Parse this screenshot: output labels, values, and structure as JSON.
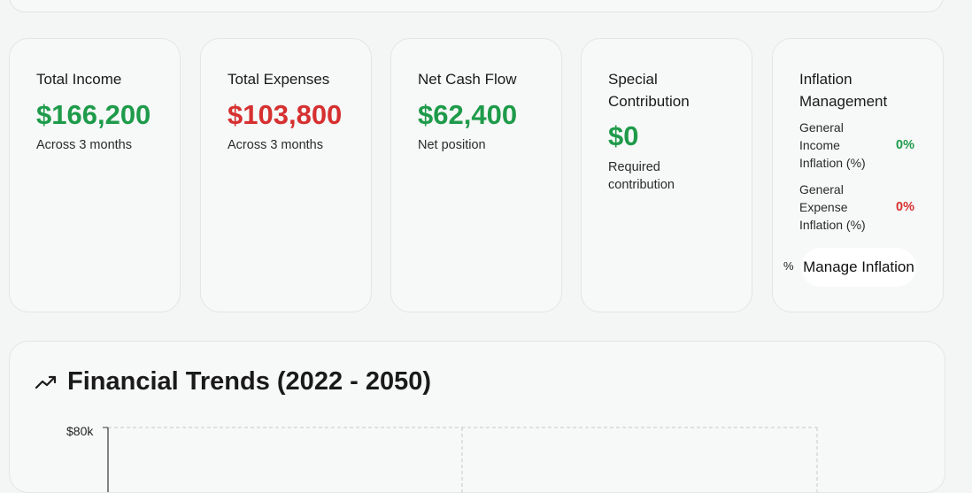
{
  "cards": {
    "income": {
      "title": "Total Income",
      "value": "$166,200",
      "subtitle": "Across 3 months",
      "color": "#1e9b4a"
    },
    "expenses": {
      "title": "Total Expenses",
      "value": "$103,800",
      "subtitle": "Across 3 months",
      "color": "#d63030"
    },
    "net": {
      "title": "Net Cash Flow",
      "value": "$62,400",
      "subtitle": "Net position",
      "color": "#1e9b4a"
    },
    "special": {
      "title": "Special Contribution",
      "value": "$0",
      "subtitle": "Required contribution",
      "color": "#1e9b4a"
    },
    "inflation": {
      "title": "Inflation Management",
      "income_label": "General Income Inflation (%)",
      "income_value": "0%",
      "expense_label": "General Expense Inflation (%)",
      "expense_value": "0%",
      "icon": "percent-icon",
      "button_label": "Manage Inflation"
    }
  },
  "trends": {
    "icon": "trending-up-icon",
    "title": "Financial Trends (2022 - 2050)",
    "y_tick": "$80k"
  }
}
